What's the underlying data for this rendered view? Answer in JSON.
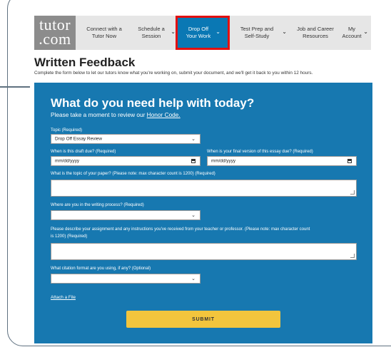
{
  "logo": {
    "line1": "tutor",
    "line2": ".com"
  },
  "nav": {
    "items": [
      {
        "label": "Connect with a Tutor Now"
      },
      {
        "label": "Schedule a Session"
      },
      {
        "label": "Drop Off Your Work"
      },
      {
        "label": "Test Prep and Self-Study"
      },
      {
        "label": "Job and Career Resources"
      },
      {
        "label": "My Account"
      }
    ]
  },
  "page": {
    "title": "Written Feedback",
    "intro": "Complete the form below to let our tutors know what you're working on, submit your document, and we'll get it back to you within 12 hours."
  },
  "form": {
    "heading": "What do you need help with today?",
    "subheading_prefix": "Please take a moment to review our ",
    "honor_code_link": "Honor Code.",
    "topic_label": "Topic (Required)",
    "topic_value": "Drop Off Essay Review",
    "draft_due_label": "When is this draft due? (Required)",
    "draft_due_placeholder": "mm/dd/yyyy",
    "final_due_label": "When is your final version of this essay due? (Required)",
    "final_due_placeholder": "mm/dd/yyyy",
    "paper_topic_label": "What is the topic of your paper? (Please note: max character count is 1200) (Required)",
    "process_label": "Where are you in the writing process? (Required)",
    "assignment_label_1": "Please describe your assignment and any instructions you've received from your teacher or professor. (Please note: max character count",
    "assignment_label_2": "is 1200) (Required)",
    "citation_label": "What citation format are you using, if any? (Optional)",
    "attach_link": "Attach a File",
    "submit_label": "SUBMIT"
  },
  "colors": {
    "panel": "#1778b0",
    "active_nav": "#0a78b4",
    "highlight_border": "#e31010",
    "submit": "#f2c53d"
  }
}
